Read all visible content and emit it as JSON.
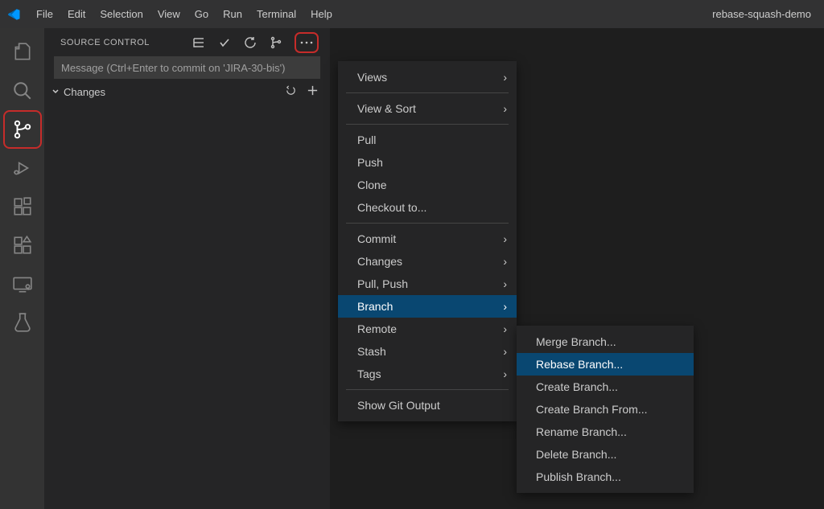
{
  "titlebar": {
    "menu": [
      "File",
      "Edit",
      "Selection",
      "View",
      "Go",
      "Run",
      "Terminal",
      "Help"
    ],
    "windowTitle": "rebase-squash-demo"
  },
  "sourceControl": {
    "title": "SOURCE CONTROL",
    "commitPlaceholder": "Message (Ctrl+Enter to commit on 'JIRA-30-bis')",
    "changesLabel": "Changes"
  },
  "contextMenu1": {
    "groups": [
      [
        {
          "label": "Views",
          "submenu": true
        },
        {
          "label": "View & Sort",
          "submenu": true
        }
      ],
      [
        {
          "label": "Pull"
        },
        {
          "label": "Push"
        },
        {
          "label": "Clone"
        },
        {
          "label": "Checkout to..."
        }
      ],
      [
        {
          "label": "Commit",
          "submenu": true
        },
        {
          "label": "Changes",
          "submenu": true
        },
        {
          "label": "Pull, Push",
          "submenu": true
        },
        {
          "label": "Branch",
          "submenu": true,
          "selected": true
        },
        {
          "label": "Remote",
          "submenu": true
        },
        {
          "label": "Stash",
          "submenu": true
        },
        {
          "label": "Tags",
          "submenu": true
        }
      ],
      [
        {
          "label": "Show Git Output"
        }
      ]
    ]
  },
  "contextMenu2": {
    "items": [
      {
        "label": "Merge Branch..."
      },
      {
        "label": "Rebase Branch...",
        "selected": true
      },
      {
        "label": "Create Branch..."
      },
      {
        "label": "Create Branch From..."
      },
      {
        "label": "Rename Branch..."
      },
      {
        "label": "Delete Branch..."
      },
      {
        "label": "Publish Branch..."
      }
    ]
  }
}
